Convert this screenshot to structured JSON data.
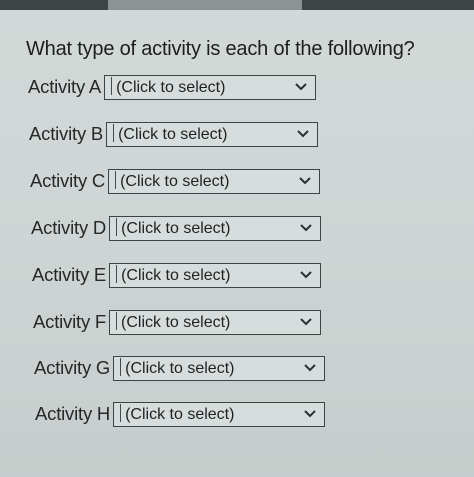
{
  "question": "What type of activity is each of the following?",
  "activities": [
    {
      "label": "Activity A",
      "value": "(Click to select)"
    },
    {
      "label": "Activity B",
      "value": "(Click to select)"
    },
    {
      "label": "Activity C",
      "value": "(Click to select)"
    },
    {
      "label": "Activity D",
      "value": "(Click to select)"
    },
    {
      "label": "Activity E",
      "value": "(Click to select)"
    },
    {
      "label": "Activity F",
      "value": "(Click to select)"
    },
    {
      "label": "Activity G",
      "value": "(Click to select)"
    },
    {
      "label": "Activity H",
      "value": "(Click to select)"
    }
  ],
  "icons": {
    "dropdown": "chevron-down-icon"
  },
  "colors": {
    "background": "#d0d6d5",
    "text": "#1c1f1f",
    "select_border": "#3e4444"
  }
}
